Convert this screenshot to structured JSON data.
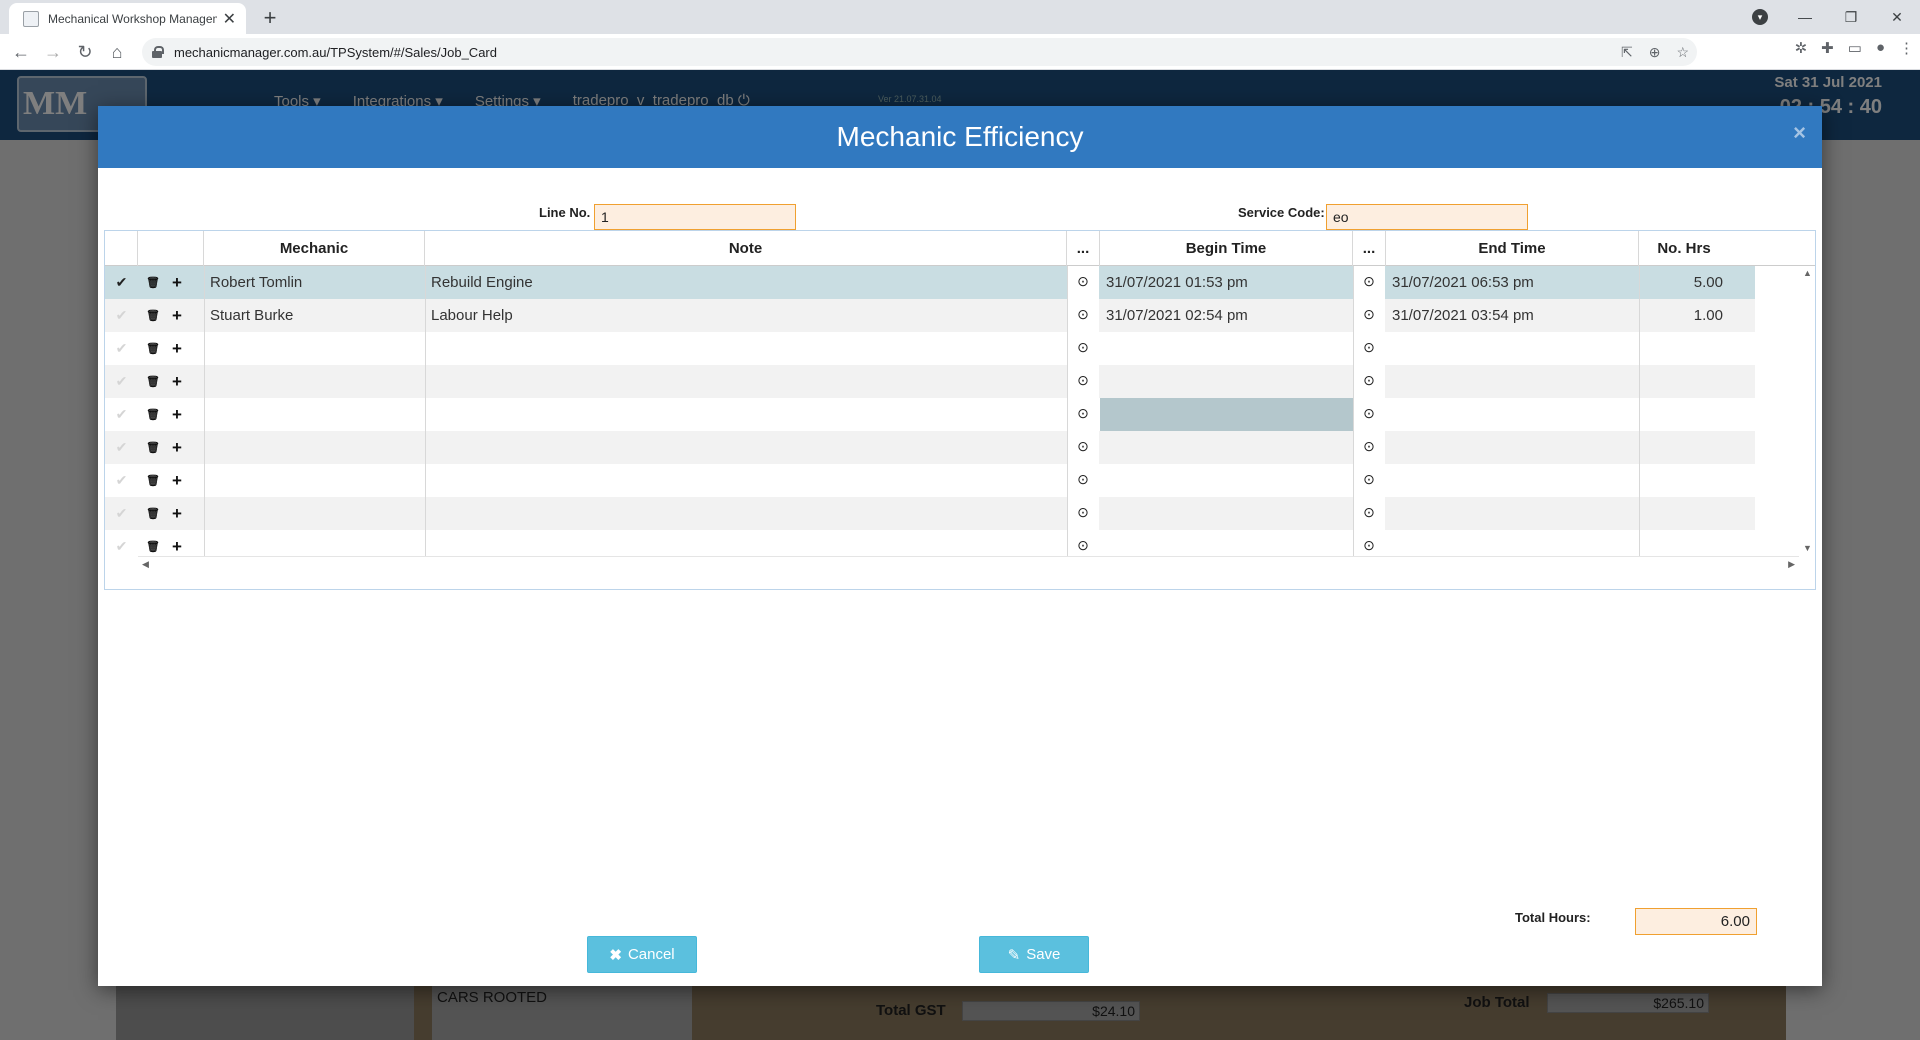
{
  "browser": {
    "tab_title": "Mechanical Workshop Managem",
    "tab_close": "✕",
    "new_tab": "+",
    "url": "mechanicmanager.com.au/TPSystem/#/Sales/Job_Card"
  },
  "app": {
    "logo": "MM",
    "nav": [
      "Tools ▾",
      "Integrations ▾",
      "Settings ▾",
      "tradepro_v_tradepro_db ⏻"
    ],
    "version": "Ver 21.07.31.04",
    "date": "Sat 31 Jul 2021",
    "clock": "02 : 54 : 40",
    "cars_rooted": "CARS ROOTED",
    "total_gst_label": "Total GST",
    "total_gst": "$24.10",
    "job_total_label": "Job Total",
    "job_total": "$265.10"
  },
  "modal": {
    "title": "Mechanic Efficiency",
    "close": "×",
    "line_no_label": "Line No.",
    "line_no": "1",
    "service_code_label": "Service Code:",
    "service_code": "eo",
    "columns": {
      "mechanic": "Mechanic",
      "note": "Note",
      "pick1": "...",
      "begin": "Begin Time",
      "pick2": "...",
      "end": "End Time",
      "hrs": "No. Hrs"
    },
    "rows": [
      {
        "mechanic": "Robert Tomlin",
        "note": "Rebuild Engine",
        "begin": "31/07/2021 01:53 pm",
        "end": "31/07/2021 06:53 pm",
        "hrs": "5.00"
      },
      {
        "mechanic": "Stuart Burke",
        "note": "Labour Help",
        "begin": "31/07/2021 02:54 pm",
        "end": "31/07/2021 03:54 pm",
        "hrs": "1.00"
      },
      {
        "mechanic": "",
        "note": "",
        "begin": "",
        "end": "",
        "hrs": ""
      },
      {
        "mechanic": "",
        "note": "",
        "begin": "",
        "end": "",
        "hrs": ""
      },
      {
        "mechanic": "",
        "note": "",
        "begin": "",
        "end": "",
        "hrs": ""
      },
      {
        "mechanic": "",
        "note": "",
        "begin": "",
        "end": "",
        "hrs": ""
      },
      {
        "mechanic": "",
        "note": "",
        "begin": "",
        "end": "",
        "hrs": ""
      },
      {
        "mechanic": "",
        "note": "",
        "begin": "",
        "end": "",
        "hrs": ""
      },
      {
        "mechanic": "",
        "note": "",
        "begin": "",
        "end": "",
        "hrs": ""
      }
    ],
    "total_hours_label": "Total Hours:",
    "total_hours": "6.00",
    "cancel_label": "Cancel",
    "save_label": "Save"
  },
  "icons": {
    "check": "✔",
    "trash": "🗑",
    "plus": "+",
    "clock": "⊙"
  },
  "colors": {
    "header_blue": "#3179c0",
    "selected_row": "#c9dde2",
    "input_bg": "#fdeee0",
    "input_border": "#f0a030",
    "button": "#5bc0de"
  }
}
